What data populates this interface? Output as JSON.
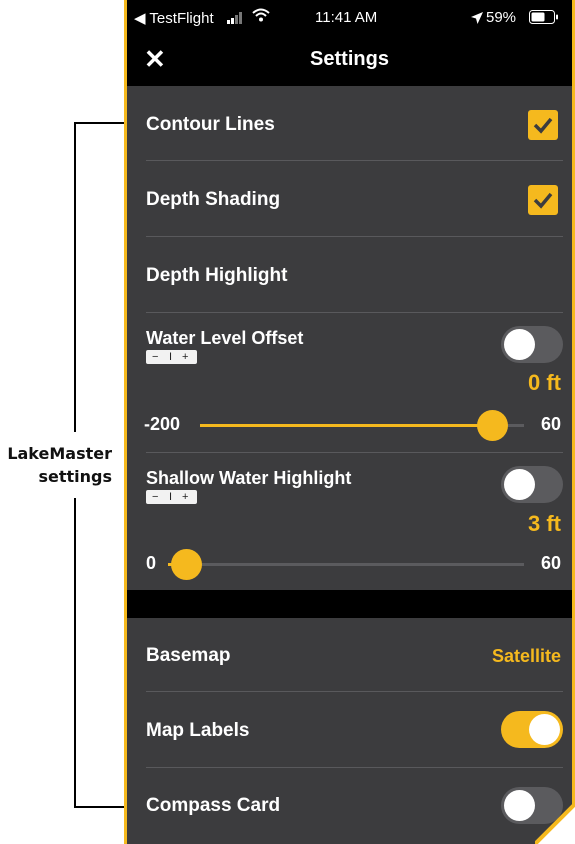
{
  "annotation": {
    "line1": "LakeMaster",
    "line2": "settings"
  },
  "status_bar": {
    "carrier": "◀ TestFlight",
    "time": "11:41 AM",
    "battery": "59%"
  },
  "nav": {
    "title": "Settings",
    "close_icon": "close-icon"
  },
  "rows": {
    "contour_lines": {
      "label": "Contour Lines",
      "checked": true
    },
    "depth_shading": {
      "label": "Depth Shading",
      "checked": true
    },
    "depth_highlight": {
      "label": "Depth Highlight"
    },
    "water_level_offset": {
      "label": "Water Level Offset",
      "enabled": false,
      "value": "0 ft",
      "stepper_minus": "−",
      "stepper_divider": "I",
      "stepper_plus": "+",
      "min": "-200",
      "max": "60",
      "slider_fraction": 0.9
    },
    "shallow_water_highlight": {
      "label": "Shallow Water Highlight",
      "enabled": false,
      "value": "3 ft",
      "stepper_minus": "−",
      "stepper_divider": "I",
      "stepper_plus": "+",
      "min": "0",
      "max": "60",
      "slider_fraction": 0.05
    },
    "basemap": {
      "label": "Basemap",
      "value": "Satellite"
    },
    "map_labels": {
      "label": "Map Labels",
      "enabled": true
    },
    "compass_card": {
      "label": "Compass Card",
      "enabled": false
    }
  },
  "colors": {
    "accent": "#f5b91e",
    "background": "#3c3c3e",
    "separator": "#59595c"
  }
}
